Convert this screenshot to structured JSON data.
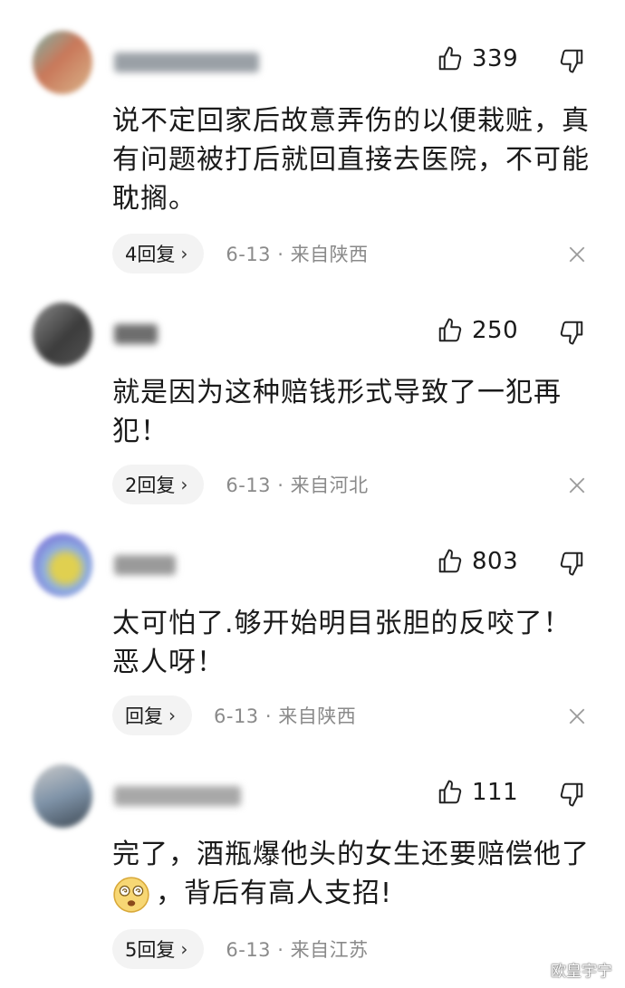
{
  "comments": [
    {
      "likes": "339",
      "text": "说不定回家后故意弄伤的以便栽赃，真有问题被打后就回直接去医院，不可能耽搁。",
      "reply_label": "4回复",
      "date": "6-13",
      "location": "来自陕西",
      "avatar_colors": [
        "#c9785a",
        "#7cb3a8",
        "#d9b48a"
      ],
      "name_color": "#9aa0a6"
    },
    {
      "likes": "250",
      "text": "就是因为这种赔钱形式导致了一犯再犯！",
      "reply_label": "2回复",
      "date": "6-13",
      "location": "来自河北",
      "avatar_colors": [
        "#555555",
        "#8a8a8a",
        "#3c3c3c"
      ],
      "name_color": "#6e6e6e"
    },
    {
      "likes": "803",
      "text": "太可怕了.够开始明目张胆的反咬了！恶人呀！",
      "reply_label": "回复",
      "date": "6-13",
      "location": "来自陕西",
      "avatar_colors": [
        "#7b6fd8",
        "#e0d050",
        "#8fb0e0"
      ],
      "name_color": "#9a9a9a"
    },
    {
      "likes": "111",
      "text_part1": "完了，酒瓶爆他头的女生还要赔偿他了",
      "text_part2": "，背后有高人支招!",
      "reply_label": "5回复",
      "date": "6-13",
      "location": "来自江苏",
      "avatar_colors": [
        "#7f93a8",
        "#c9c9c9",
        "#3f4a55"
      ],
      "name_color": "#a8a8a8"
    }
  ],
  "meta_separator": "·",
  "watermark": "欧皇宇宁",
  "icons": {
    "like": "thumbs-up-icon",
    "dislike": "thumbs-down-icon",
    "close": "close-icon",
    "chevron": "chevron-right-icon",
    "emoji": "dizzy-face-emoji-icon"
  }
}
